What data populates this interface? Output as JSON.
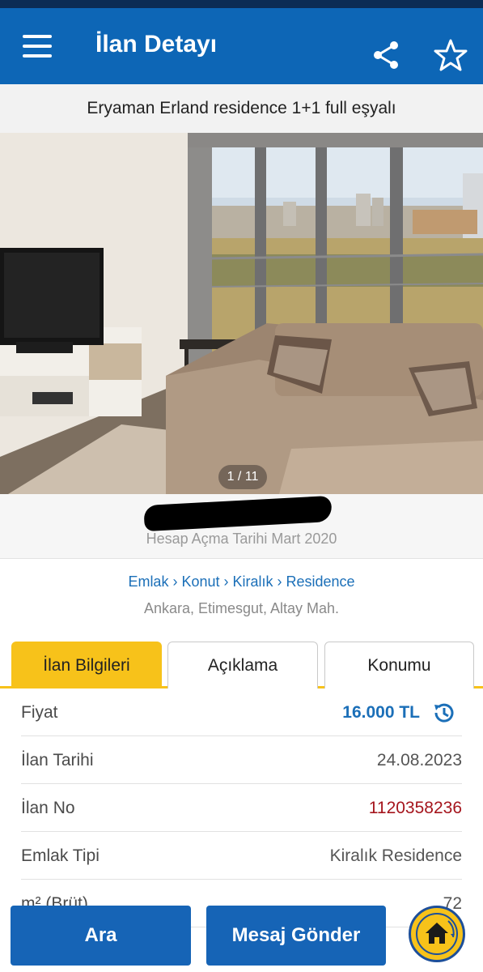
{
  "appbar": {
    "title": "İlan Detayı",
    "menu_icon": "menu-icon",
    "share_icon": "share-icon",
    "favorite_icon": "star-icon"
  },
  "listing": {
    "title": "Eryaman Erland residence 1+1 full eşyalı",
    "photo_counter": "1 / 11"
  },
  "seller": {
    "account_opened": "Hesap Açma Tarihi  Mart 2020"
  },
  "breadcrumb": {
    "items": [
      "Emlak",
      "Konut",
      "Kiralık",
      "Residence"
    ],
    "text": "Emlak › Konut › Kiralık › Residence"
  },
  "location": "Ankara, Etimesgut, Altay Mah.",
  "tabs": [
    {
      "label": "İlan Bilgileri",
      "active": true
    },
    {
      "label": "Açıklama",
      "active": false
    },
    {
      "label": "Konumu",
      "active": false
    }
  ],
  "details": [
    {
      "label": "Fiyat",
      "value": "16.000 TL"
    },
    {
      "label": "İlan Tarihi",
      "value": "24.08.2023"
    },
    {
      "label": "İlan No",
      "value": "1120358236"
    },
    {
      "label": "Emlak Tipi",
      "value": "Kiralık Residence"
    },
    {
      "label": "m² (Brüt)",
      "value": "72"
    }
  ],
  "bottom": {
    "search_label": "Ara",
    "message_label": "Mesaj Gönder"
  },
  "colors": {
    "primary": "#0d66b6",
    "accent": "#f7c21a",
    "price": "#1b6fb8",
    "listing_no": "#a5151d"
  }
}
